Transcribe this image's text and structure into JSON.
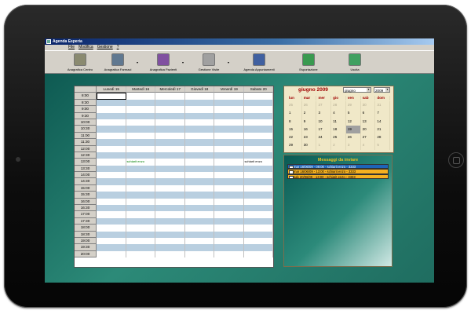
{
  "window": {
    "title": "Agenda Esperia"
  },
  "menu": [
    "File",
    "Modifica",
    "Gestione",
    "?"
  ],
  "toolbar": [
    {
      "label": "Anagrafica Centro",
      "icon": "building-icon",
      "color": "#8a8a70",
      "dropdown": false
    },
    {
      "label": "Anagrafica Farmaci",
      "icon": "pills-icon",
      "color": "#607890",
      "dropdown": true
    },
    {
      "label": "Anagrafica Pazienti",
      "icon": "patients-icon",
      "color": "#8050a0",
      "dropdown": true
    },
    {
      "label": "Gestione Visite",
      "icon": "visits-icon",
      "color": "#a0a0a0",
      "dropdown": true
    },
    {
      "label": "Agenda Appuntamenti",
      "icon": "calendar-grid-icon",
      "color": "#4060a0",
      "dropdown": false
    },
    {
      "label": "Esportazione",
      "icon": "globe-export-icon",
      "color": "#3a9a50",
      "dropdown": false
    },
    {
      "label": "Uscita",
      "icon": "exit-icon",
      "color": "#40a060",
      "dropdown": false
    }
  ],
  "planner": {
    "days": [
      "Lunedì 15",
      "Martedì 16",
      "Mercoledì 17",
      "Giovedì 18",
      "Venerdì 19",
      "Sabato 20"
    ],
    "times": [
      "8:00",
      "8:30",
      "9:00",
      "9:30",
      "10:00",
      "10:30",
      "11:00",
      "11:30",
      "12:00",
      "12:30",
      "13:00",
      "13:30",
      "14:00",
      "14:30",
      "15:00",
      "15:30",
      "16:00",
      "16:30",
      "17:00",
      "17:30",
      "18:00",
      "18:30",
      "19:00",
      "19:30",
      "20:00"
    ],
    "appointments": [
      {
        "time": "13:00",
        "day": 1,
        "text": "schiarit enzo"
      },
      {
        "time": "13:00",
        "day": 5,
        "text": "schiarit enzo"
      }
    ]
  },
  "calendar": {
    "title": "giugno 2009",
    "month_select": "giugno",
    "year_select": "2009",
    "dow": [
      "lun",
      "mar",
      "mer",
      "gio",
      "ven",
      "sab",
      "dom"
    ],
    "weeks": [
      [
        "25",
        "26",
        "27",
        "28",
        "29",
        "30",
        "31"
      ],
      [
        "1",
        "2",
        "3",
        "4",
        "5",
        "6",
        "7"
      ],
      [
        "8",
        "9",
        "10",
        "11",
        "12",
        "13",
        "14"
      ],
      [
        "15",
        "16",
        "17",
        "18",
        "19",
        "20",
        "21"
      ],
      [
        "22",
        "23",
        "24",
        "25",
        "26",
        "27",
        "28"
      ],
      [
        "29",
        "30",
        "1",
        "2",
        "3",
        "4",
        "5"
      ]
    ],
    "today": "19"
  },
  "messages": {
    "title": "Messaggi da inviare",
    "items": [
      {
        "text": "mar 16/06/09 - 09:00 - schiarit enzo - 3333",
        "selected": true
      },
      {
        "text": "mar 16/06/09 - 13:00 - schiarit enzo - 3333",
        "selected": false
      },
      {
        "text": "sab 20/06/09 - 13:00 - schiarit enzo - 3333",
        "selected": false
      }
    ]
  }
}
